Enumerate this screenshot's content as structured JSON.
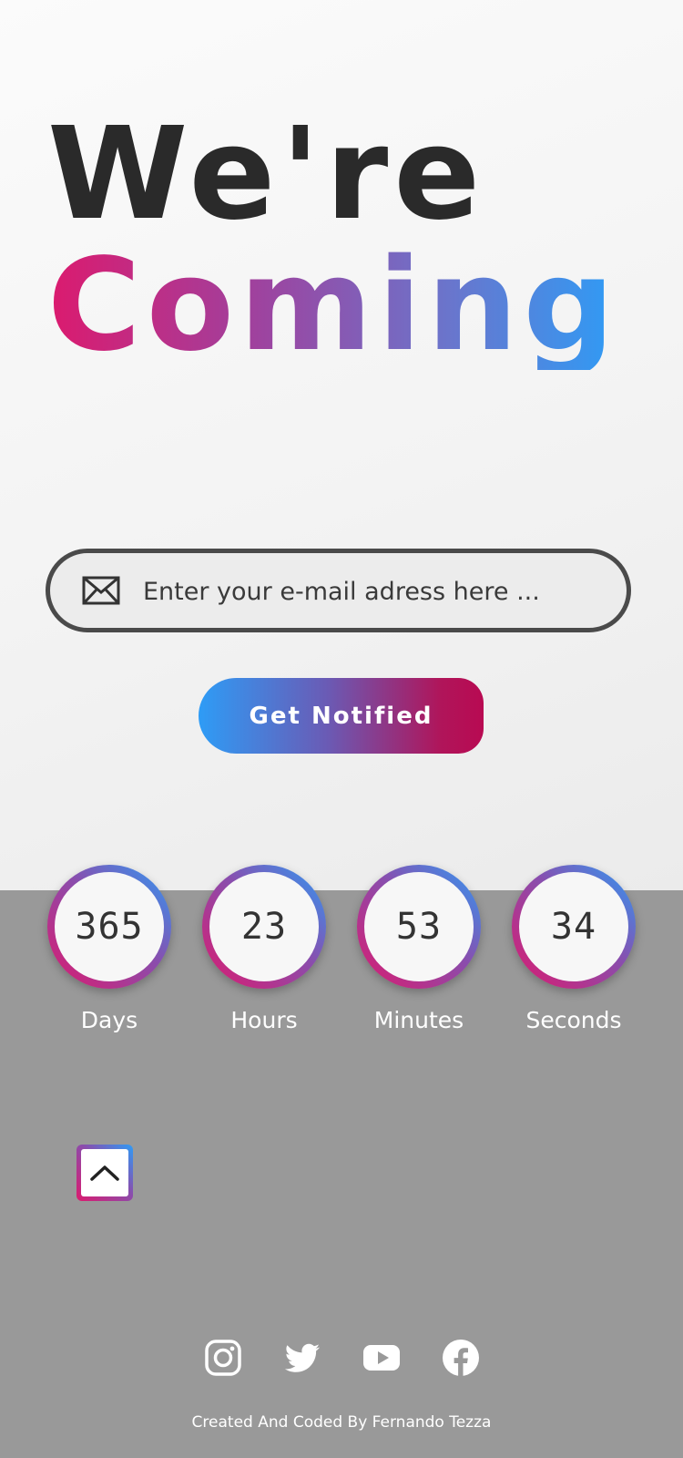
{
  "hero": {
    "line1": "We're",
    "line2": "Coming"
  },
  "signup": {
    "email_placeholder": "Enter your e-mail adress here ...",
    "email_icon": "envelope-icon",
    "button_label": "Get Notified"
  },
  "countdown": [
    {
      "value": "365",
      "label": "Days"
    },
    {
      "value": "23",
      "label": "Hours"
    },
    {
      "value": "53",
      "label": "Minutes"
    },
    {
      "value": "34",
      "label": "Seconds"
    }
  ],
  "scroll_top_icon": "chevron-up-icon",
  "social": [
    {
      "name": "instagram-icon"
    },
    {
      "name": "twitter-icon"
    },
    {
      "name": "youtube-icon"
    },
    {
      "name": "facebook-icon"
    }
  ],
  "footer": {
    "credit": "Created And Coded By Fernando Tezza"
  },
  "colors": {
    "gradient_pink": "#dc1a6e",
    "gradient_purple": "#8a4dad",
    "gradient_blue": "#2e9cf6",
    "heading_dark": "#2a2a2a",
    "lower_bg": "#999999"
  }
}
